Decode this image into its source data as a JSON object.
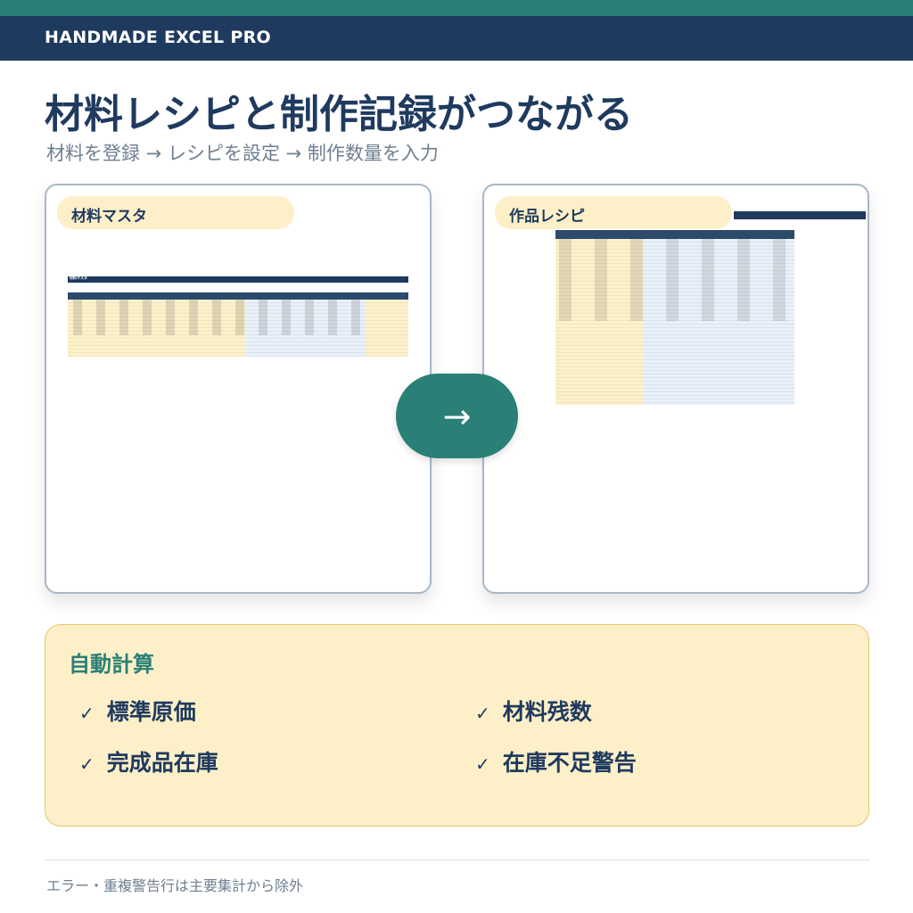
{
  "brand": "HANDMADE EXCEL PRO",
  "headline": "材料レシピと制作記録がつながる",
  "subhead": "材料を登録 → レシピを設定 → 制作数量を入力",
  "panels": {
    "left": {
      "tag": "材料マスタ",
      "sheet_title": "材料マスタ"
    },
    "right": {
      "tag": "作品レシピ"
    }
  },
  "arrow": "→",
  "auto": {
    "title": "自動計算",
    "check": "✓",
    "features": [
      "標準原価",
      "材料残数",
      "完成品在庫",
      "在庫不足警告"
    ]
  },
  "footnote": "エラー・重複警告行は主要集計から除外",
  "colors": {
    "navy": "#1f3a5f",
    "teal": "#2a7f76",
    "cream": "#fdf0c8",
    "panel_border": "#a9b7c6"
  }
}
